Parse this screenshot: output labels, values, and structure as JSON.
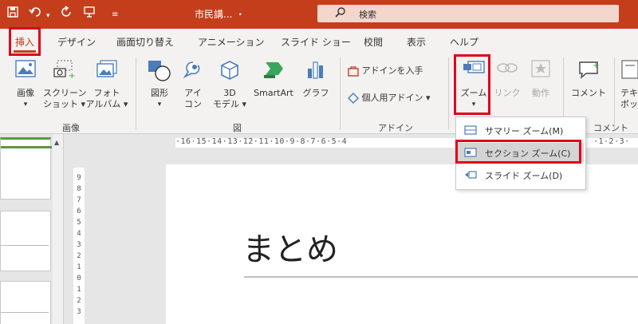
{
  "titlebar": {
    "doc_title": "市民講... ・",
    "search_placeholder": "検索"
  },
  "tabs": [
    {
      "label": "挿入"
    },
    {
      "label": "デザイン"
    },
    {
      "label": "画面切り替え"
    },
    {
      "label": "アニメーション"
    },
    {
      "label": "スライド ショー"
    },
    {
      "label": "校閲"
    },
    {
      "label": "表示"
    },
    {
      "label": "ヘルプ"
    }
  ],
  "ribbon": {
    "image_group": {
      "label": "画像",
      "items": [
        {
          "line1": "画像",
          "line2": "▾"
        },
        {
          "line1": "スクリーン",
          "line2": "ショット ▾"
        },
        {
          "line1": "フォト",
          "line2": "アルバム ▾"
        }
      ]
    },
    "figure_group": {
      "label": "図",
      "items": [
        {
          "line1": "図形",
          "line2": "▾"
        },
        {
          "line1": "アイ",
          "line2": "コン"
        },
        {
          "line1": "3D",
          "line2": "モデル ▾"
        },
        {
          "line1": "SmartArt",
          "line2": ""
        },
        {
          "line1": "グラフ",
          "line2": ""
        }
      ]
    },
    "addin_group": {
      "label": "アドイン",
      "get_addins": "アドインを入手",
      "my_addins": "個人用アドイン ▾"
    },
    "links_group": {
      "zoom": "ズーム",
      "zoom_arrow": "▾",
      "link": "リンク",
      "action": "動作",
      "label": "リンク"
    },
    "comment_group": {
      "comment": "コメント",
      "label": "コメント"
    },
    "text_partial": {
      "line1": "テキ",
      "line2": "ボッ"
    }
  },
  "zoom_menu": {
    "items": [
      {
        "label": "サマリー ズーム(M)"
      },
      {
        "label": "セクション ズーム(C)"
      },
      {
        "label": "スライド ズーム(D)"
      }
    ]
  },
  "ruler": {
    "top": "·16·15·14·13·12·11·10·9·8·7·6·5·4",
    "top_right": "·1·2·3·",
    "left": [
      "9",
      "8",
      "7",
      "6",
      "5",
      "4",
      "3",
      "2",
      "1",
      "0",
      "1",
      "2",
      "3",
      "4"
    ]
  },
  "slide": {
    "title": "まとめ"
  },
  "colors": {
    "accent": "#c43e1c",
    "highlight": "#e0001a"
  }
}
